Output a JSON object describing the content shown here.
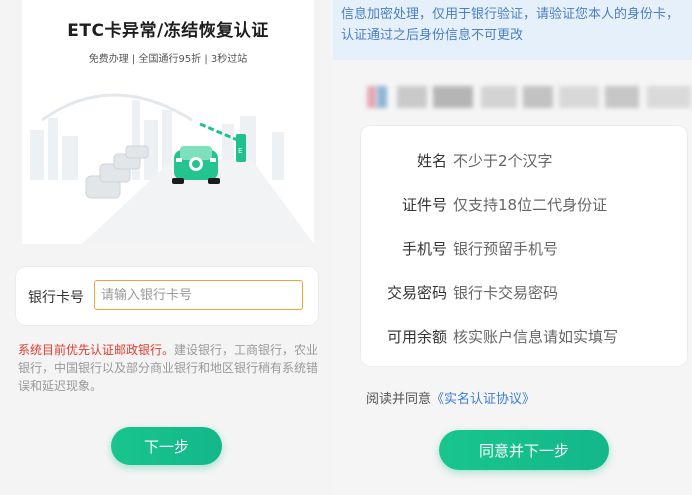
{
  "left": {
    "hero": {
      "title": "ETC卡异常/冻结恢复认证",
      "subtitle": "免费办理 | 全国通行95折 | 3秒过站"
    },
    "card_field": {
      "label": "银行卡号",
      "placeholder": "请输入银行卡号",
      "value": ""
    },
    "notice": {
      "highlight": "系统目前优先认证邮政银行。",
      "rest": "建设银行，工商银行，农业银行，中国银行以及部分商业银行和地区银行稍有系统错误和延迟现象。"
    },
    "next_button": "下一步"
  },
  "right": {
    "banner": "信息加密处理，仅用于银行验证，请验证您本人的身份卡，认证通过之后身份信息不可更改",
    "form": [
      {
        "label": "姓名",
        "placeholder": "不少于2个汉字"
      },
      {
        "label": "证件号",
        "placeholder": "仅支持18位二代身份证"
      },
      {
        "label": "手机号",
        "placeholder": "银行预留手机号"
      },
      {
        "label": "交易密码",
        "placeholder": "银行卡交易密码"
      },
      {
        "label": "可用余额",
        "placeholder": "核实账户信息请如实填写"
      }
    ],
    "agreement": {
      "prefix": "阅读并同意",
      "link": "《实名认证协议》"
    },
    "agree_button": "同意并下一步"
  },
  "colors": {
    "accent": "#17c08c",
    "warning": "#e23b2e",
    "link": "#3b7dd8",
    "input_border": "#e8a33a"
  }
}
